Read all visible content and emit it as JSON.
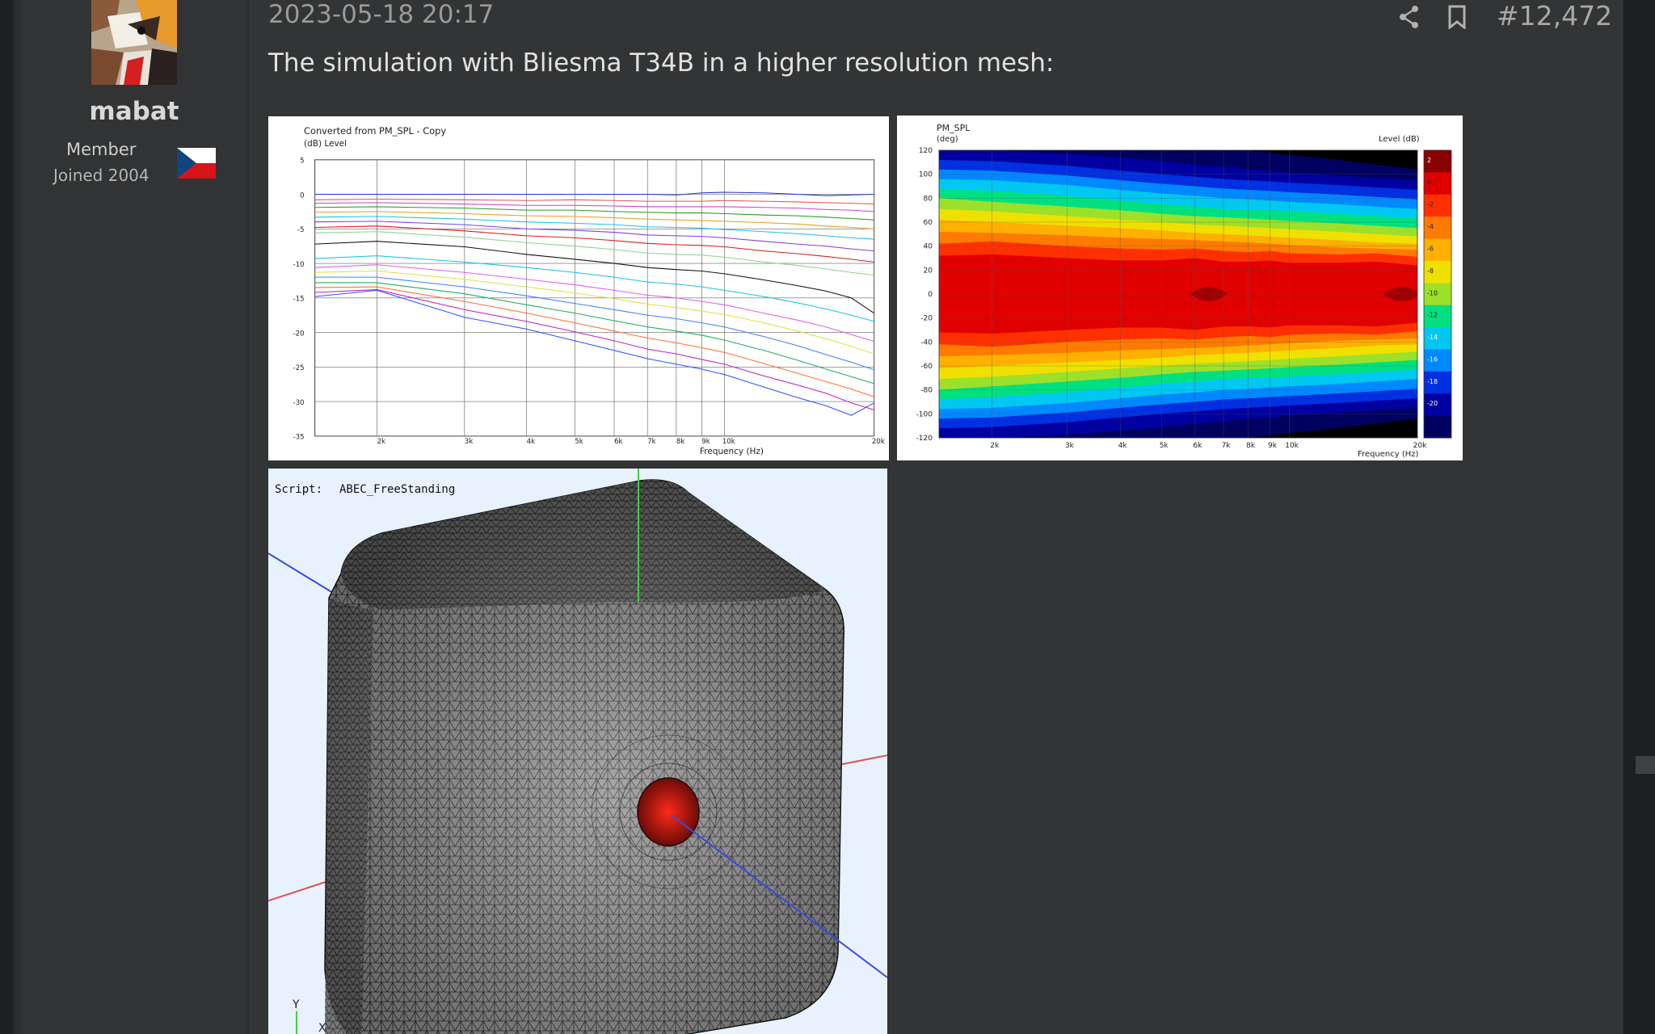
{
  "user": {
    "username": "mabat",
    "role": "Member",
    "joined": "Joined 2004",
    "flag": "czech-flag"
  },
  "post": {
    "date": "2023-05-18 20:17",
    "number": "#12,472",
    "text": "The simulation with Bliesma T34B in a higher resolution mesh:",
    "actions": [
      "share-icon",
      "bookmark-icon"
    ]
  },
  "colors": {
    "background": "#2b2d2e",
    "post_bg": "#323435",
    "username": "#d8d8d8",
    "muted": "#9a9a9a"
  },
  "chart_data": [
    {
      "type": "line",
      "title": "Converted from PM_SPL - Copy",
      "ylabel": "(dB)  Level",
      "xlabel": "Frequency  (Hz)",
      "x_scale": "log",
      "xlim": [
        1500,
        20000
      ],
      "ylim": [
        -35,
        5
      ],
      "yticks": [
        "5",
        "0",
        "-5",
        "-10",
        "-15",
        "-20",
        "-25",
        "-30",
        "-35"
      ],
      "xticks": [
        "2k",
        "3k",
        "4k",
        "5k",
        "6k",
        "7k",
        "8k",
        "9k",
        "10k",
        "20k"
      ],
      "x": [
        1500,
        2000,
        3000,
        4000,
        5000,
        6000,
        7000,
        8000,
        9000,
        10000,
        12000,
        14000,
        16000,
        18000,
        20000
      ],
      "grid": true,
      "series": [
        {
          "color": "#2233cc",
          "values": [
            0,
            0,
            0,
            0,
            0,
            0,
            0,
            -0.1,
            0.2,
            0.3,
            0.2,
            0,
            -0.2,
            -0.1,
            0
          ]
        },
        {
          "color": "#e05a5a",
          "values": [
            -0.8,
            -0.7,
            -0.8,
            -0.9,
            -0.8,
            -0.9,
            -1,
            -1,
            -1,
            -0.9,
            -1,
            -1.1,
            -1.2,
            -1.3,
            -1.4
          ]
        },
        {
          "color": "#cc44cc",
          "values": [
            -1.3,
            -1.2,
            -1.4,
            -1.6,
            -1.6,
            -1.7,
            -1.8,
            -1.8,
            -1.8,
            -1.8,
            -1.9,
            -2,
            -2.2,
            -2.3,
            -2.5
          ]
        },
        {
          "color": "#2a9a2a",
          "values": [
            -1.9,
            -1.8,
            -2,
            -2.3,
            -2.3,
            -2.5,
            -2.6,
            -2.7,
            -2.7,
            -2.8,
            -3,
            -3.1,
            -3.3,
            -3.5,
            -3.7
          ]
        },
        {
          "color": "#e8a020",
          "values": [
            -2.6,
            -2.5,
            -2.8,
            -3.1,
            -3.2,
            -3.4,
            -3.6,
            -3.7,
            -3.8,
            -3.9,
            -4.1,
            -4.3,
            -4.6,
            -4.8,
            -5
          ]
        },
        {
          "color": "#20c0e0",
          "values": [
            -3.3,
            -3.2,
            -3.6,
            -4,
            -4.2,
            -4.4,
            -4.7,
            -4.8,
            -4.9,
            -5.1,
            -5.4,
            -5.7,
            -6,
            -6.3,
            -6.5
          ]
        },
        {
          "color": "#8040e0",
          "values": [
            -4,
            -3.9,
            -4.4,
            -5,
            -5.2,
            -5.5,
            -5.9,
            -6,
            -6.1,
            -6.3,
            -6.8,
            -7.2,
            -7.5,
            -7.9,
            -8.2
          ]
        },
        {
          "color": "#d02020",
          "values": [
            -4.8,
            -4.6,
            -5.3,
            -6,
            -6.3,
            -6.7,
            -7.1,
            -7.3,
            -7.4,
            -7.6,
            -8.2,
            -8.6,
            -9,
            -9.4,
            -9.8
          ]
        },
        {
          "color": "#90d090",
          "values": [
            -5.6,
            -5.4,
            -6.2,
            -7,
            -7.5,
            -8,
            -8.5,
            -8.7,
            -8.8,
            -9.1,
            -9.8,
            -10.3,
            -10.8,
            -11.3,
            -11.7
          ]
        },
        {
          "color": "#111111",
          "values": [
            -7.2,
            -6.8,
            -7.6,
            -8.7,
            -9.4,
            -10,
            -10.6,
            -10.9,
            -11.1,
            -11.5,
            -12.4,
            -13.2,
            -14,
            -15,
            -17.2
          ]
        },
        {
          "color": "#1ac0e8",
          "values": [
            -9.3,
            -8.9,
            -9.8,
            -10.6,
            -11.3,
            -12,
            -12.7,
            -13,
            -13.4,
            -13.9,
            -14.8,
            -15.7,
            -16.6,
            -17.5,
            -18.4
          ]
        },
        {
          "color": "#e060e0",
          "values": [
            -10.6,
            -10.2,
            -11.3,
            -12.3,
            -13.1,
            -13.9,
            -14.6,
            -15,
            -15.5,
            -16,
            -17.2,
            -18.2,
            -19.2,
            -20.3,
            -21.3
          ]
        },
        {
          "color": "#e0e040",
          "values": [
            -11.3,
            -11.1,
            -12.3,
            -13.4,
            -14.3,
            -15.1,
            -15.9,
            -16.4,
            -16.9,
            -17.4,
            -18.6,
            -19.8,
            -20.9,
            -22,
            -23.1
          ]
        },
        {
          "color": "#4080ff",
          "values": [
            -12,
            -12,
            -13.4,
            -14.7,
            -15.8,
            -16.7,
            -17.5,
            -18,
            -18.6,
            -19.2,
            -20.6,
            -21.9,
            -23.2,
            -24.3,
            -25.4
          ]
        },
        {
          "color": "#20b060",
          "values": [
            -12.8,
            -12.8,
            -14.4,
            -16,
            -17.2,
            -18.3,
            -19.2,
            -19.8,
            -20.4,
            -21.1,
            -22.6,
            -24,
            -25.3,
            -26.4,
            -27.4
          ]
        },
        {
          "color": "#ff7030",
          "values": [
            -13.5,
            -13.4,
            -15.5,
            -17.2,
            -18.6,
            -19.8,
            -20.8,
            -21.5,
            -22.2,
            -22.9,
            -24.5,
            -25.9,
            -27.1,
            -28.2,
            -29.3
          ]
        },
        {
          "color": "#c020c0",
          "values": [
            -14.2,
            -13.8,
            -16.7,
            -18.4,
            -19.9,
            -21.2,
            -22.4,
            -23.1,
            -23.9,
            -24.6,
            -26.3,
            -27.6,
            -28.8,
            -30.2,
            -31.2
          ]
        },
        {
          "color": "#3050ff",
          "values": [
            -14.8,
            -13.9,
            -17.8,
            -19.5,
            -21.2,
            -22.6,
            -23.8,
            -24.6,
            -25.3,
            -26.1,
            -27.9,
            -29.4,
            -30.6,
            -32,
            -30.2
          ]
        }
      ]
    },
    {
      "type": "heatmap",
      "title": "PM_SPL",
      "ylabel": "(deg)",
      "xlabel": "Frequency  (Hz)",
      "colorbar_label": "Level  (dB)",
      "x_scale": "log",
      "xlim": [
        1500,
        20000
      ],
      "ylim": [
        -120,
        120
      ],
      "yticks": [
        "120",
        "100",
        "80",
        "60",
        "40",
        "20",
        "0",
        "-20",
        "-40",
        "-60",
        "-80",
        "-100",
        "-120"
      ],
      "xticks": [
        "2k",
        "3k",
        "4k",
        "5k",
        "6k",
        "7k",
        "8k",
        "9k",
        "10k",
        "20k"
      ],
      "colorbar_ticks": [
        "2",
        "0",
        "-2",
        "-4",
        "-6",
        "-8",
        "-10",
        "-12",
        "-14",
        "-16",
        "-18",
        "-20"
      ],
      "colorbar_colors": [
        "#8b0000",
        "#e00000",
        "#ff3000",
        "#ff7a00",
        "#ffb000",
        "#f0e000",
        "#9de02a",
        "#00e080",
        "#00c8f0",
        "#0088ff",
        "#0030e0",
        "#0000a0",
        "#000060"
      ]
    }
  ],
  "mesh_view": {
    "script_label": "Script:",
    "script_name": "ABEC_FreeStanding",
    "axis_y": "Y",
    "axis_x": "X"
  }
}
